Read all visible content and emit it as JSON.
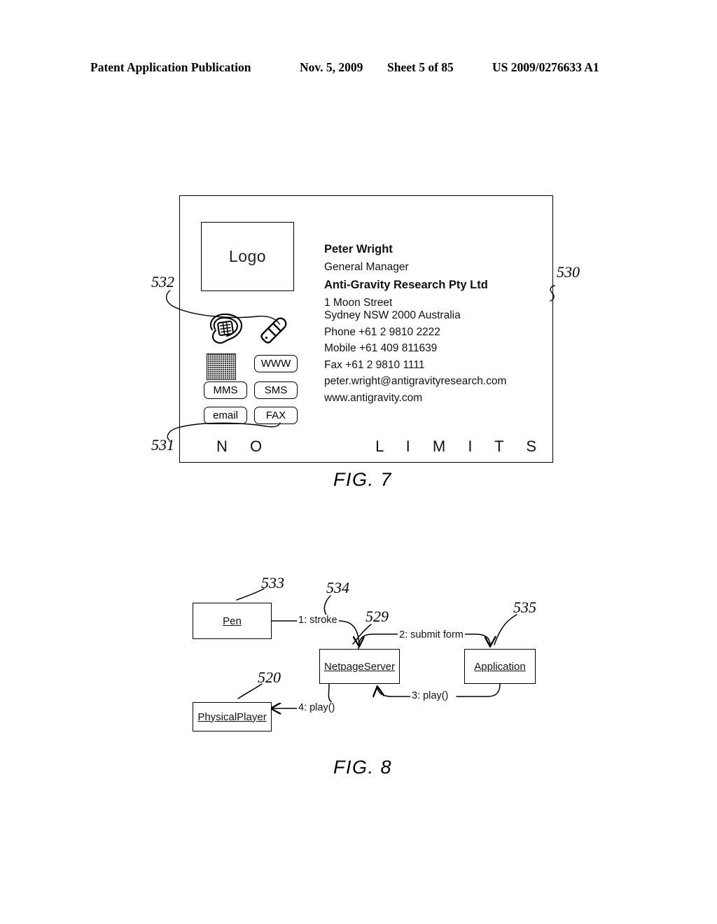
{
  "header": {
    "publication": "Patent Application Publication",
    "date": "Nov. 5, 2009",
    "sheet": "Sheet 5 of 85",
    "patent_number": "US 2009/0276633 A1"
  },
  "figures": [
    {
      "caption": "FIG. 7",
      "reference": "530",
      "type": "business-card",
      "card": {
        "logo_placeholder": "Logo",
        "name": "Peter Wright",
        "job_title": "General Manager",
        "company": "Anti-Gravity Research Pty Ltd",
        "address_line1": "1 Moon Street",
        "address_line2": "Sydney NSW 2000 Australia",
        "phone": "Phone +61 2 9810 2222",
        "mobile": "Mobile +61 409 811639",
        "fax": "Fax +61 2 9810 1111",
        "email": "peter.wright@antigravityresearch.com",
        "website": "www.antigravity.com",
        "tagline_left": "N O",
        "tagline_right": "L I M I T S",
        "buttons": [
          {
            "label": "WWW",
            "name": "www-button"
          },
          {
            "label": "MMS",
            "name": "mms-button"
          },
          {
            "label": "SMS",
            "name": "sms-button"
          },
          {
            "label": "email",
            "name": "email-button"
          },
          {
            "label": "FAX",
            "name": "fax-button"
          }
        ],
        "icons": [
          {
            "name": "landline-phone-icon"
          },
          {
            "name": "mobile-phone-icon"
          },
          {
            "name": "netpage-tag-pattern-icon"
          }
        ]
      },
      "numerals": [
        {
          "value": "530",
          "points_to": "business-card-outline"
        },
        {
          "value": "532",
          "points_to": "mobile-phone-icon"
        },
        {
          "value": "531",
          "points_to": "interactive-button-group"
        }
      ]
    },
    {
      "caption": "FIG. 8",
      "type": "uml-collaboration-diagram",
      "objects": [
        {
          "label": "Pen",
          "numeral": "533",
          "name": "pen-object"
        },
        {
          "label": "NetpageServer",
          "numeral": "529",
          "name": "netpage-server-object"
        },
        {
          "label": "Application",
          "numeral": "535",
          "name": "application-object"
        },
        {
          "label": "PhysicalPlayer",
          "numeral": "520",
          "name": "physical-player-object"
        }
      ],
      "messages": [
        {
          "label": "1: stroke",
          "numeral": "534",
          "from": "Pen",
          "to": "NetpageServer"
        },
        {
          "label": "2: submit form",
          "from": "NetpageServer",
          "to": "Application"
        },
        {
          "label": "3: play()",
          "from": "Application",
          "to": "NetpageServer"
        },
        {
          "label": "4: play()",
          "from": "NetpageServer",
          "to": "PhysicalPlayer"
        }
      ]
    }
  ]
}
